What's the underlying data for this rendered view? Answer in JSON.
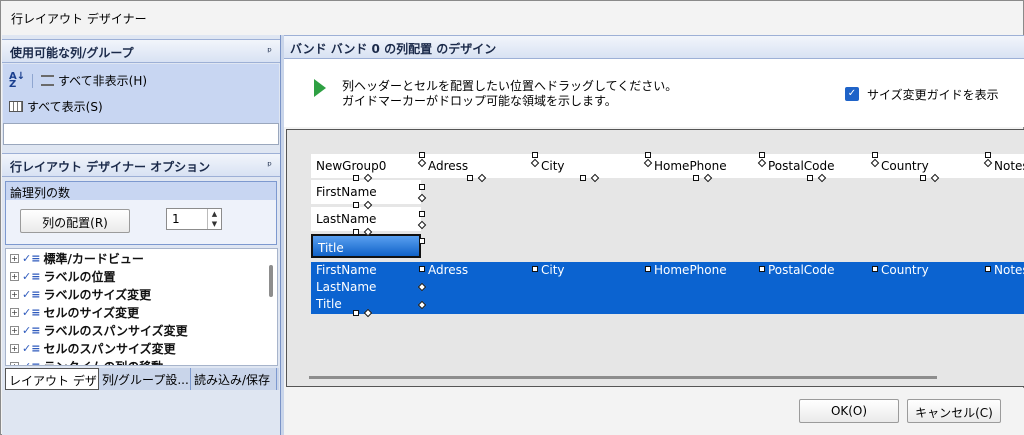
{
  "window": {
    "title": "行レイアウト デザイナー"
  },
  "columns_panel": {
    "title": "使用可能な列/グループ",
    "pin": "ᵖ",
    "hide_all": "すべて非表示(H)",
    "show_all": "すべて表示(S)"
  },
  "options_panel": {
    "title": "行レイアウト デザイナー オプション",
    "pin": "ᵖ",
    "group_label": "論理列の数",
    "arrange_button": "列の配置(R)",
    "count_value": "1",
    "tree_items": [
      "標準/カードビュー",
      "ラベルの位置",
      "ラベルのサイズ変更",
      "セルのサイズ変更",
      "ラベルのスパンサイズ変更",
      "セルのスパンサイズ変更",
      "ランタイムの列の移動"
    ]
  },
  "tabs": [
    "レイアウト デザ...",
    "列/グループ設...",
    "読み込み/保存"
  ],
  "design_panel": {
    "title": "バンド バンド 0 の列配置 のデザイン",
    "instruction_line1": "列ヘッダーとセルを配置したい位置へドラッグしてください。",
    "instruction_line2": "ガイドマーカーがドロップ可能な領域を示します。",
    "show_guides_label": "サイズ変更ガイドを表示",
    "show_guides_checked": true
  },
  "layout": {
    "header_cells": [
      "NewGroup0",
      "Adress",
      "City",
      "HomePhone",
      "PostalCode",
      "Country",
      "Notes"
    ],
    "label_cells": [
      "FirstName",
      "LastName",
      "Title"
    ],
    "cell_row": [
      "FirstName",
      "Adress",
      "City",
      "HomePhone",
      "PostalCode",
      "Country",
      "Notes"
    ],
    "cell_rows_extra": [
      "LastName",
      "Title"
    ]
  },
  "buttons": {
    "ok": "OK(O)",
    "cancel": "キャンセル(C)"
  },
  "colors": {
    "selection": "#0b63d0",
    "panel": "#c8d6f2",
    "play": "#2ea043"
  },
  "icons": [
    "sort-az-icon",
    "list-icon",
    "grid-icon",
    "pin-icon",
    "play-icon",
    "checkbox-icon",
    "plus-expand-icon",
    "check-list-icon"
  ]
}
